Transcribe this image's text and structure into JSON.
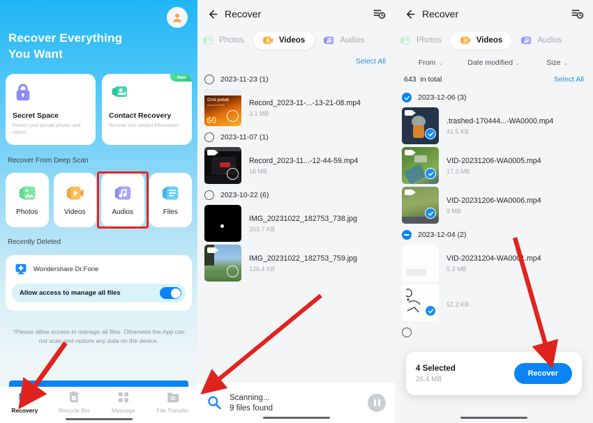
{
  "panel1": {
    "avatar_icon": "user-avatar-icon",
    "hero_title_line1": "Recover Everything",
    "hero_title_line2": "You Want",
    "cards": [
      {
        "title": "Secret Space",
        "desc": "Protect your private photos and videos",
        "icon": "lock-icon",
        "badge": ""
      },
      {
        "title": "Contact Recovery",
        "desc": "Recover lost contact information.",
        "icon": "contact-icon",
        "badge": "New"
      }
    ],
    "deep_scan_label": "Recover From Deep Scan",
    "deep_scan_tiles": [
      {
        "label": "Photos",
        "icon": "photos-icon"
      },
      {
        "label": "Videos",
        "icon": "videos-icon"
      },
      {
        "label": "Audios",
        "icon": "audios-icon"
      },
      {
        "label": "Files",
        "icon": "files-icon"
      }
    ],
    "recently_deleted_label": "Recently Deleted",
    "app_name": "Wondershare Dr.Fone",
    "app_icon": "drfone-icon",
    "allow_label": "Allow access to manage all files",
    "toggle_on": true,
    "note": "*Please allow access to manage all files. Otherwise the App can not scan and restore any data on the device.",
    "nav": [
      {
        "label": "Recovery",
        "icon": "recovery-icon",
        "active": true
      },
      {
        "label": "Recycle Bin",
        "icon": "recycle-bin-icon",
        "active": false
      },
      {
        "label": "Message",
        "icon": "message-icon",
        "active": false
      },
      {
        "label": "File Transfer",
        "icon": "file-transfer-icon",
        "active": false
      }
    ]
  },
  "panel2": {
    "header_title": "Recover",
    "back_icon": "back-arrow-icon",
    "history_icon": "recovery-history-icon",
    "tabs": [
      {
        "label": "Photos",
        "icon": "photos-icon",
        "active": false
      },
      {
        "label": "Videos",
        "icon": "videos-icon",
        "active": true
      },
      {
        "label": "Audios",
        "icon": "audios-icon",
        "active": false
      }
    ],
    "select_all": "Select All",
    "groups": [
      {
        "date_label": "2023-11-23 (1)",
        "checked": false,
        "files": [
          {
            "name": "Record_2023-11-...-13-21-08.mp4",
            "size": "3.1 MB",
            "selected": false,
            "thumb": "poster-orange"
          }
        ]
      },
      {
        "date_label": "2023-11-07 (1)",
        "checked": false,
        "files": [
          {
            "name": "Record_2023-11...-12-44-59.mp4",
            "size": "16 MB",
            "selected": false,
            "thumb": "car-dark"
          }
        ]
      },
      {
        "date_label": "2023-10-22 (6)",
        "checked": false,
        "files": [
          {
            "name": "IMG_20231022_182753_738.jpg",
            "size": "203.7 KB",
            "selected": false,
            "thumb": "black-dot"
          },
          {
            "name": "IMG_20231022_182753_759.jpg",
            "size": "126.4 KB",
            "selected": false,
            "thumb": "landscape-sky"
          }
        ]
      }
    ],
    "scan_status": "Scanning...",
    "scan_found": "9 files found",
    "scan_icon": "magnifier-icon",
    "pause_icon": "pause-icon"
  },
  "panel3": {
    "header_title": "Recover",
    "back_icon": "back-arrow-icon",
    "history_icon": "recovery-history-icon",
    "tabs": [
      {
        "label": "Photos",
        "icon": "photos-icon",
        "active": false
      },
      {
        "label": "Videos",
        "icon": "videos-icon",
        "active": true
      },
      {
        "label": "Audios",
        "icon": "audios-icon",
        "active": false
      }
    ],
    "filters": [
      {
        "label": "From",
        "caret": "⌄"
      },
      {
        "label": "Date modified",
        "caret": "⌄"
      },
      {
        "label": "Size",
        "caret": "⌄"
      }
    ],
    "total_count": "643",
    "total_suffix": "in total",
    "select_all": "Select All",
    "groups": [
      {
        "date_label": "2023-12-06 (3)",
        "state": "checked",
        "files": [
          {
            "name": ".trashed-170444...-WA0000.mp4",
            "size": "41.5 KB",
            "selected": true,
            "thumb": "cartoon-dark"
          },
          {
            "name": "VID-20231206-WA0005.mp4",
            "size": "17.3 MB",
            "selected": true,
            "thumb": "aerial-green"
          },
          {
            "name": "VID-20231206-WA0006.mp4",
            "size": "9 MB",
            "selected": true,
            "thumb": "aerial-field"
          }
        ]
      },
      {
        "date_label": "2023-12-04 (2)",
        "state": "partial",
        "files": [
          {
            "name": "VID-20231204-WA0001.mp4",
            "size": "5.3 MB",
            "selected": false,
            "thumb": "white-blank"
          },
          {
            "name": "",
            "size": "52.2 KB",
            "selected": true,
            "thumb": "sketch-white"
          }
        ]
      }
    ],
    "recover_bar": {
      "count_label": "4 Selected",
      "size_label": "26.4 MB",
      "button_label": "Recover"
    }
  },
  "colors": {
    "accent_blue": "#0a84f5",
    "link_blue": "#1f93e8",
    "annotation_red": "#e0231f",
    "highlight_red": "#e8231f",
    "toggle_on": "#0a84f5"
  }
}
